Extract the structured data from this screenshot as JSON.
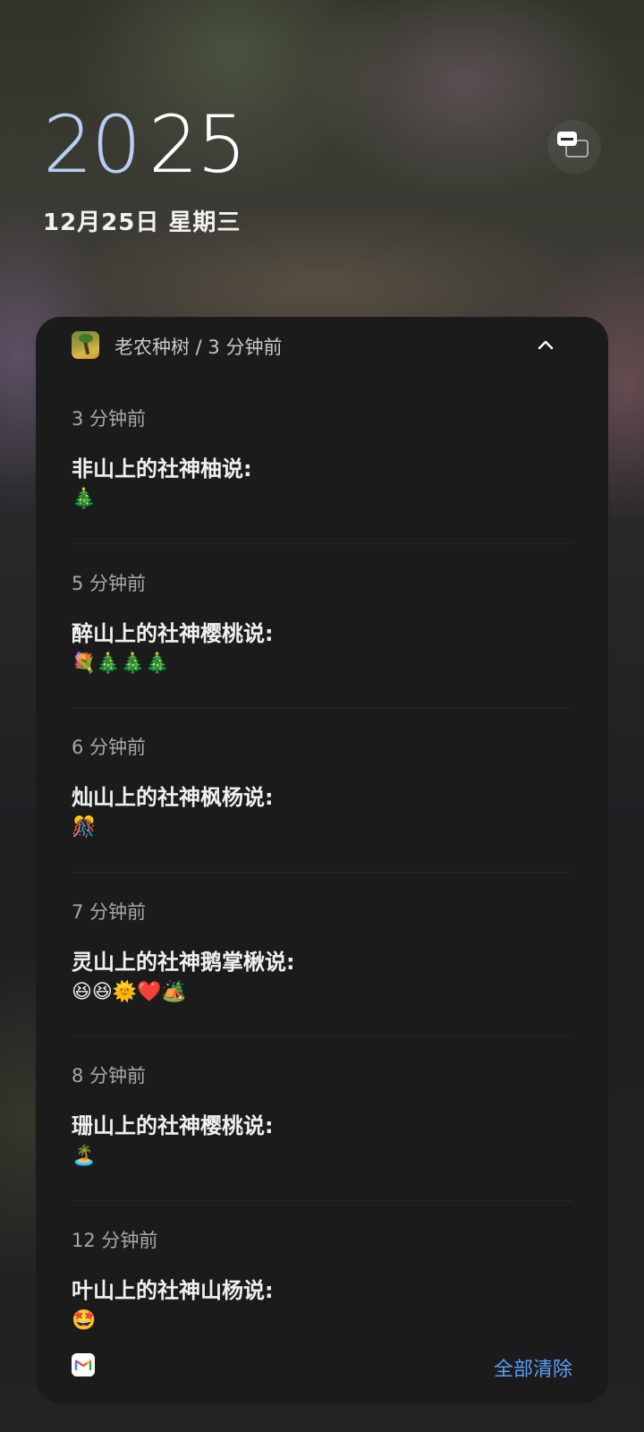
{
  "lockscreen": {
    "clock_hours": "20",
    "clock_minutes": "25",
    "date": "12月25日 星期三"
  },
  "notification_group": {
    "app_title": "老农种树 / 3 分钟前",
    "items": [
      {
        "time": "3 分钟前",
        "sender": "非山上的社神柚说:",
        "body": "🎄"
      },
      {
        "time": "5 分钟前",
        "sender": "醉山上的社神樱桃说:",
        "body": "💐🎄🎄🎄"
      },
      {
        "time": "6 分钟前",
        "sender": "灿山上的社神枫杨说:",
        "body": "🎊"
      },
      {
        "time": "7 分钟前",
        "sender": "灵山上的社神鹅掌楸说:",
        "body": "😆😆🌞❤️🏕️"
      },
      {
        "time": "8 分钟前",
        "sender": "珊山上的社神樱桃说:",
        "body": "🏝️"
      },
      {
        "time": "12 分钟前",
        "sender": "叶山上的社神山杨说:",
        "body": "🤩"
      }
    ],
    "clear_all_label": "全部清除"
  },
  "colors": {
    "clock_hours": "#b8cef2",
    "accent_link": "#5b9df5",
    "panel_bg": "#1b1b1c"
  },
  "icons": {
    "notification_toggle": "stacked-cards-icon",
    "app_icon": "laonong-zhongshu-app-icon",
    "collapse": "chevron-up-icon",
    "footer_app": "gmail-icon"
  }
}
